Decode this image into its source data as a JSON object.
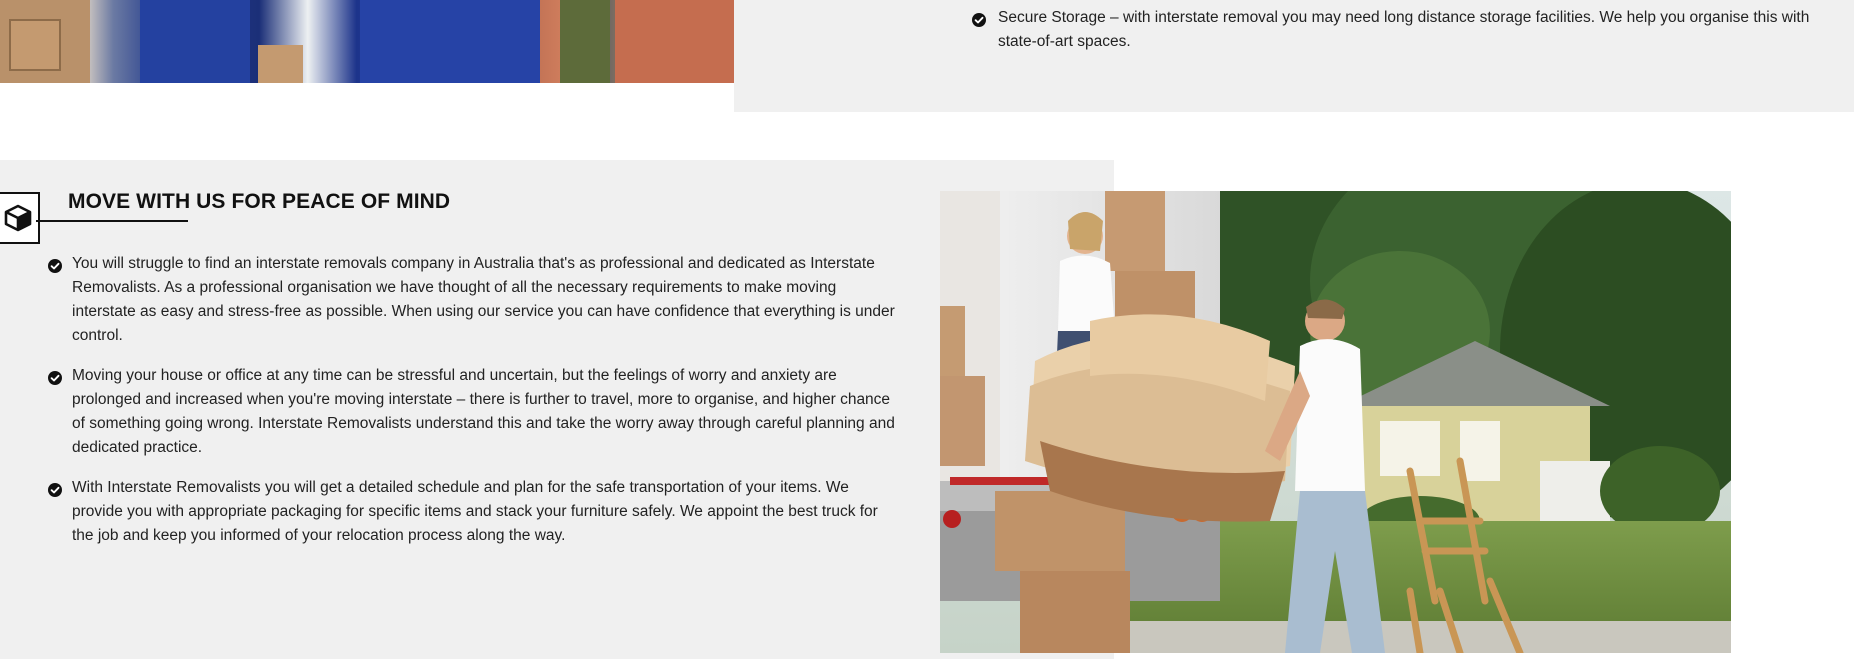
{
  "top_item": {
    "text": "Secure Storage – with interstate removal you may need long distance storage facilities. We help you organise this with state-of-art spaces."
  },
  "section": {
    "title": "MOVE WITH US FOR PEACE OF MIND",
    "icon": "box-icon",
    "items": [
      "You will struggle to find an interstate removals company in Australia that's as professional and dedicated as Interstate Removalists. As a professional organisation we have thought of all the necessary requirements to make moving interstate as easy and stress-free as possible. When using our service you can have confidence that everything is under control.",
      "Moving your house or office at any time can be stressful and uncertain, but the feelings of worry and anxiety are prolonged and increased when you're moving interstate – there is further to travel, more to organise, and higher chance of something going wrong. Interstate Removalists understand this and take the worry away through careful planning and dedicated practice.",
      "With Interstate Removalists you will get a detailed schedule and plan for the safe transportation of your items. We provide you with appropriate packaging for specific items and stack your furniture safely. We appoint the best truck for the job and keep you informed of your relocation process along the way."
    ]
  },
  "colors": {
    "panel_bg": "#f0f0f0",
    "text": "#222222",
    "heading": "#111111"
  }
}
